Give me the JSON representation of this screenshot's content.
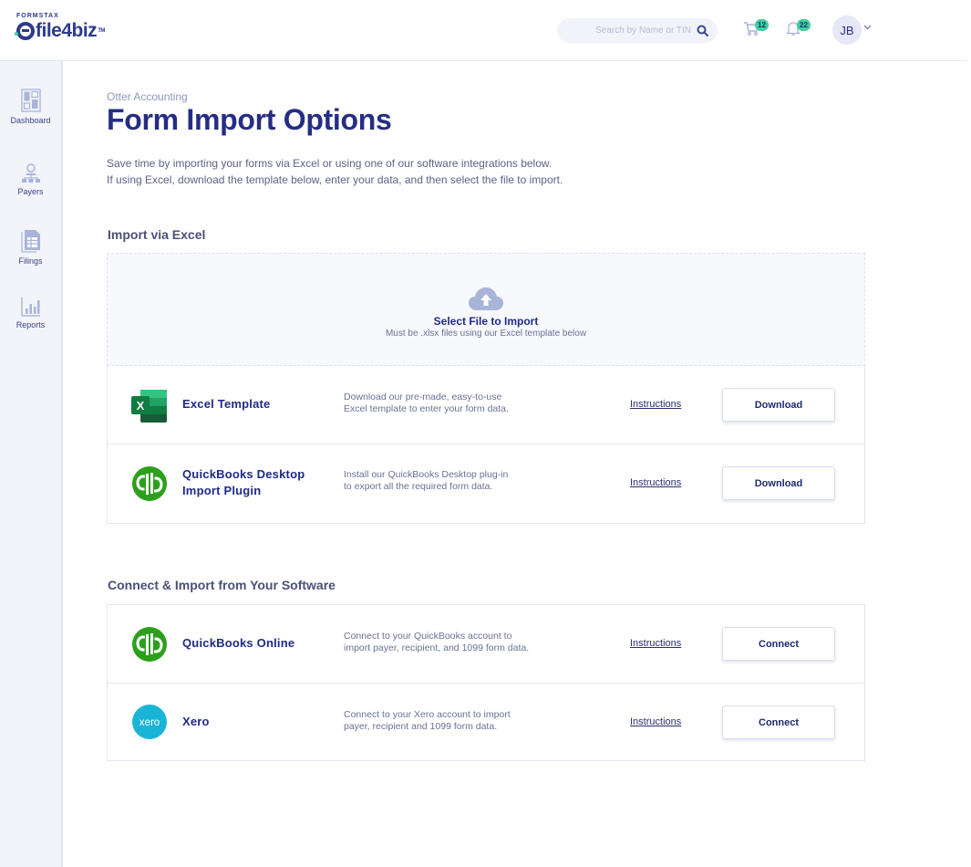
{
  "header": {
    "logo": {
      "top": "FORMSTAX",
      "main": "file4biz",
      "tm": "TM"
    },
    "search": {
      "placeholder": "Search by Name or TIN"
    },
    "cart": {
      "count": "12"
    },
    "notifications": {
      "count": "22"
    },
    "user": {
      "initials": "JB"
    }
  },
  "sidebar": {
    "items": [
      {
        "label": "Dashboard",
        "icon": "dashboard-icon"
      },
      {
        "label": "Payers",
        "icon": "payers-icon"
      },
      {
        "label": "Filings",
        "icon": "filings-icon"
      },
      {
        "label": "Reports",
        "icon": "reports-icon"
      }
    ]
  },
  "page": {
    "org_name": "Otter Accounting",
    "title": "Form Import Options",
    "intro_line1": "Save time by importing your forms via Excel or using one of our software integrations below.",
    "intro_line2": "If using Excel, download the template below, enter your data, and then select the file to import."
  },
  "excel_section": {
    "title": "Import via Excel",
    "upload": {
      "title": "Select File to Import",
      "subtitle": "Must be .xlsx files using our Excel template below"
    },
    "rows": [
      {
        "name_line1": "Excel Template",
        "name_line2": "",
        "desc_line1": "Download our pre-made, easy-to-use",
        "desc_line2": "Excel template to enter your form data.",
        "link": "Instructions",
        "button": "Download"
      },
      {
        "name_line1": "QuickBooks Desktop",
        "name_line2": "Import Plugin",
        "desc_line1": "Install our QuickBooks Desktop plug-in",
        "desc_line2": "to export all the required form data.",
        "link": "Instructions",
        "button": "Download"
      }
    ]
  },
  "software_section": {
    "title": "Connect & Import from Your Software",
    "rows": [
      {
        "name_line1": "QuickBooks Online",
        "desc_line1": "Connect to your QuickBooks account to",
        "desc_line2": "import payer, recipient, and 1099 form data.",
        "link": "Instructions",
        "button": "Connect"
      },
      {
        "name_line1": "Xero",
        "logo_text": "xero",
        "desc_line1": "Connect to your Xero account to import",
        "desc_line2": "payer, recipient and 1099 form data.",
        "link": "Instructions",
        "button": "Connect"
      }
    ]
  },
  "colors": {
    "brand_navy": "#262d84",
    "accent_green": "#3ecf9a",
    "excel_green": "#1d7a45",
    "quickbooks_green": "#2ca01c",
    "xero_blue": "#13b5ea",
    "sidebar_bg": "#f3f4fa"
  }
}
